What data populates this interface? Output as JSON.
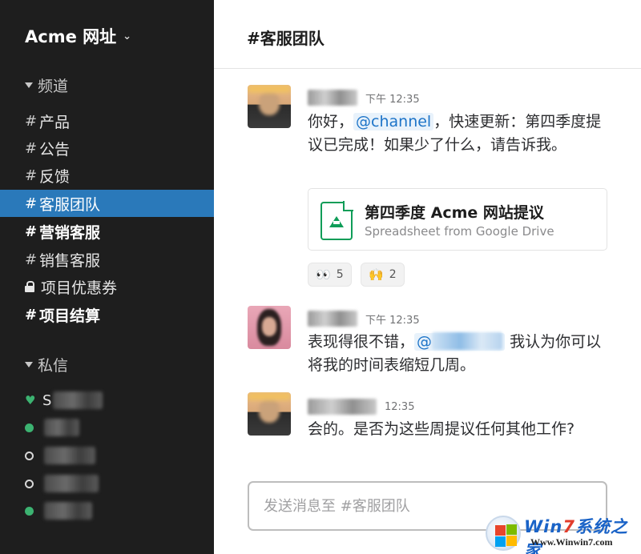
{
  "sidebar": {
    "team_name": "Acme 网址",
    "channels_title": "频道",
    "channels": [
      {
        "label": "产品"
      },
      {
        "label": "公告"
      },
      {
        "label": "反馈"
      },
      {
        "label": "客服团队"
      },
      {
        "label": "营销客服"
      },
      {
        "label": "销售客服"
      },
      {
        "label": "项目优惠券"
      },
      {
        "label": "项目结算"
      }
    ],
    "dm_title": "私信",
    "dms": [
      {
        "initial": "S"
      },
      {
        "initial": ""
      },
      {
        "initial": ""
      },
      {
        "initial": ""
      },
      {
        "initial": ""
      }
    ]
  },
  "main": {
    "channel_title": "#客服团队",
    "messages": [
      {
        "time": "下午 12:35",
        "text_pre": "你好，",
        "mention": "@channel",
        "text_post": "，快速更新：第四季度提议已完成！如果少了什么，请告诉我。",
        "attachment": {
          "title": "第四季度 Acme 网站提议",
          "subtitle": "Spreadsheet from Google Drive"
        },
        "reactions": [
          {
            "emoji": "👀",
            "count": "5"
          },
          {
            "emoji": "🙌",
            "count": "2"
          }
        ]
      },
      {
        "time": "下午 12:35",
        "text_pre": "表现得很不错，",
        "mention": "@",
        "text_post": "我认为你可以将我的时间表缩短几周。"
      },
      {
        "time": "12:35",
        "text": "会的。是否为这些周提议任何其他工作?"
      }
    ],
    "composer": {
      "placeholder": "发送消息至 #客服团队"
    }
  },
  "watermark": {
    "brand_a": "Win",
    "brand_b": "7",
    "brand_c": "系统之家",
    "url": "Www.Winwin7.com"
  }
}
